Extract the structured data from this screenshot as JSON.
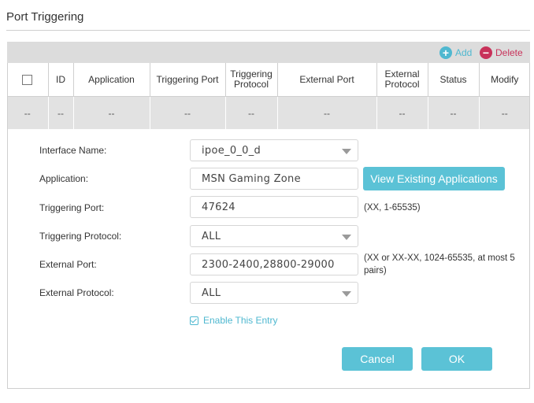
{
  "page": {
    "title": "Port Triggering"
  },
  "toolbar": {
    "add_label": "Add",
    "delete_label": "Delete",
    "add_icon": "plus-circle-icon",
    "delete_icon": "minus-circle-icon"
  },
  "table": {
    "headers": [
      "ID",
      "Application",
      "Triggering Port",
      "Triggering Protocol",
      "External Port",
      "External Protocol",
      "Status",
      "Modify"
    ],
    "rows": [
      [
        "--",
        "--",
        "--",
        "--",
        "--",
        "--",
        "--",
        "--",
        "--"
      ]
    ]
  },
  "form": {
    "interface_name": {
      "label": "Interface Name:",
      "value": "ipoe_0_0_d"
    },
    "application": {
      "label": "Application:",
      "value": "MSN Gaming Zone",
      "button": "View Existing Applications"
    },
    "triggering_port": {
      "label": "Triggering Port:",
      "value": "47624",
      "hint": "(XX, 1-65535)"
    },
    "triggering_protocol": {
      "label": "Triggering Protocol:",
      "value": "ALL"
    },
    "external_port": {
      "label": "External Port:",
      "value": "2300-2400,28800-29000",
      "hint": "(XX or XX-XX, 1024-65535, at most 5 pairs)"
    },
    "external_protocol": {
      "label": "External Protocol:",
      "value": "ALL"
    },
    "enable_entry": {
      "label": "Enable This Entry",
      "checked": true
    }
  },
  "actions": {
    "cancel_label": "Cancel",
    "ok_label": "OK"
  },
  "colors": {
    "accent": "#5bc2d6",
    "delete": "#c8325a",
    "toolbar_bg": "#dcdcdc",
    "row_bg": "#e2e2e2"
  }
}
